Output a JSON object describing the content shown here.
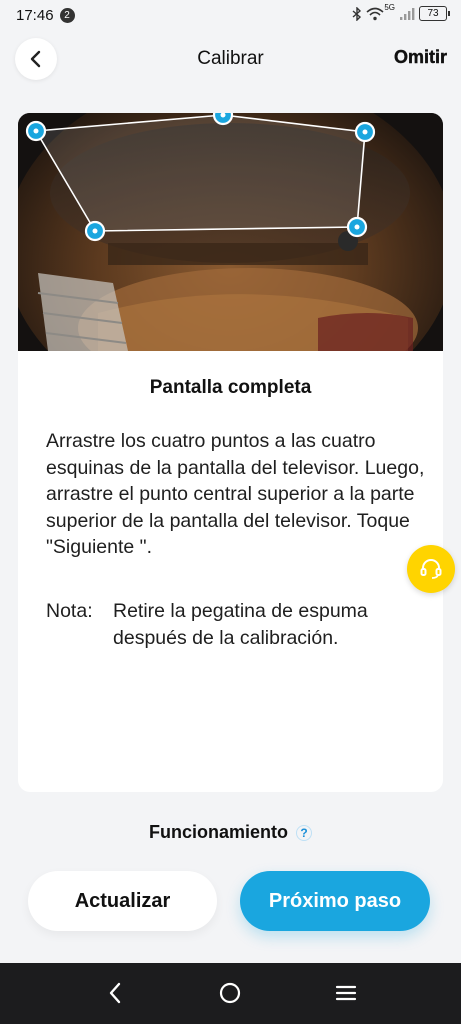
{
  "status_bar": {
    "time": "17:46",
    "notification_count": "2",
    "network_label": "5G",
    "battery": "73"
  },
  "header": {
    "title": "Calibrar",
    "skip_label": "Omitir"
  },
  "card": {
    "title": "Pantalla completa",
    "instructions": "Arrastre los cuatro puntos a las cuatro esquinas de la pantalla del televisor. Luego, arrastre el punto central superior a la parte superior de la pantalla del televisor. Toque \"Siguiente \".",
    "note_label": "Nota:",
    "note_text": "Retire la pegatina de espuma después de la calibración."
  },
  "operation": {
    "label": "Funcionamiento",
    "help_icon": "?"
  },
  "buttons": {
    "update": "Actualizar",
    "next": "Próximo paso"
  },
  "colors": {
    "accent": "#1aa6df",
    "support": "#ffd400",
    "background": "#f3f4f6"
  },
  "icons": {
    "back": "chevron-left-icon",
    "support": "headset-icon",
    "nav_back": "nav-back-icon",
    "nav_home": "nav-home-icon",
    "nav_menu": "nav-menu-icon"
  }
}
